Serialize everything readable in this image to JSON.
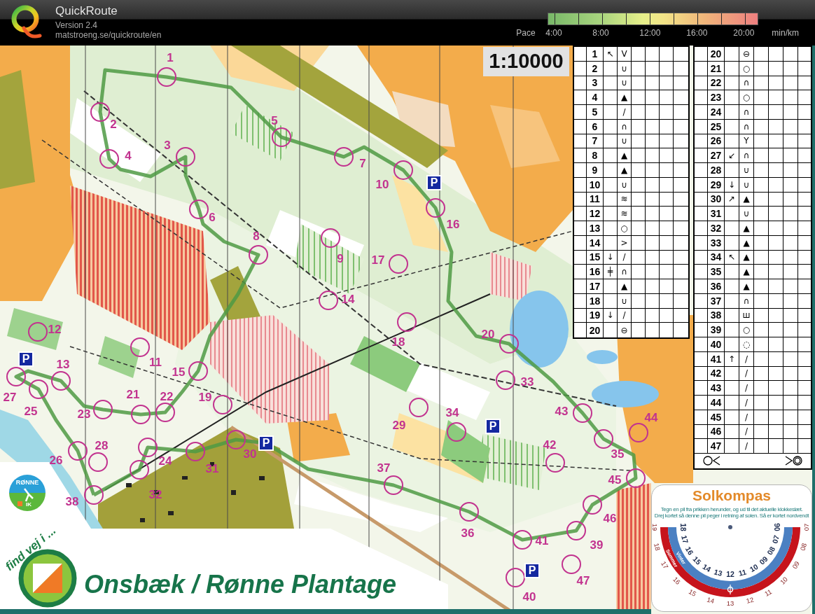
{
  "app_header": {
    "title": "QuickRoute",
    "version": "Version 2.4",
    "url": "matstroeng.se/quickroute/en"
  },
  "pace_legend": {
    "label": "Pace",
    "ticks": [
      "4:00",
      "8:00",
      "12:00",
      "16:00",
      "20:00"
    ],
    "unit": "min/km"
  },
  "map": {
    "scale": "1:10000",
    "controls": [
      "1",
      "2",
      "3",
      "4",
      "5",
      "6",
      "7",
      "8",
      "9",
      "10",
      "11",
      "12",
      "13",
      "14",
      "15",
      "16",
      "17",
      "18",
      "19",
      "20",
      "21",
      "22",
      "23",
      "24",
      "25",
      "26",
      "27",
      "28",
      "29",
      "30",
      "31",
      "32",
      "33",
      "34",
      "35",
      "36",
      "37",
      "38",
      "39",
      "40",
      "41",
      "42",
      "43",
      "44",
      "45",
      "46",
      "47"
    ],
    "parking_signs": [
      "P",
      "P",
      "P",
      "P",
      "P"
    ],
    "description_sheets": [
      {
        "start_finish_row": false,
        "rows": [
          {
            "number": "1",
            "column_c": "↖",
            "column_d": "V"
          },
          {
            "number": "2",
            "column_d": "∪"
          },
          {
            "number": "3",
            "column_d": "∪"
          },
          {
            "number": "4",
            "column_d": "▲"
          },
          {
            "number": "5",
            "column_d": "/"
          },
          {
            "number": "6",
            "column_d": "∩"
          },
          {
            "number": "7",
            "column_d": "∪"
          },
          {
            "number": "8",
            "column_d": "▲"
          },
          {
            "number": "9",
            "column_d": "▲"
          },
          {
            "number": "10",
            "column_d": "∪"
          },
          {
            "number": "11",
            "column_d": "≋"
          },
          {
            "number": "12",
            "column_d": "≋"
          },
          {
            "number": "13",
            "column_d": "○"
          },
          {
            "number": "14",
            "column_d": ">"
          },
          {
            "number": "15",
            "column_c": "↓",
            "column_d": "/"
          },
          {
            "number": "16",
            "column_c": "╪",
            "column_d": "∩"
          },
          {
            "number": "17",
            "column_d": "▲"
          },
          {
            "number": "18",
            "column_d": "∪"
          },
          {
            "number": "19",
            "column_c": "↓",
            "column_d": "/"
          },
          {
            "number": "20",
            "column_d": "⊖"
          }
        ]
      },
      {
        "start_finish_row": true,
        "rows": [
          {
            "number": "20",
            "column_d": "⊖"
          },
          {
            "number": "21",
            "column_d": "○"
          },
          {
            "number": "22",
            "column_d": "∩"
          },
          {
            "number": "23",
            "column_d": "○"
          },
          {
            "number": "24",
            "column_d": "∩"
          },
          {
            "number": "25",
            "column_d": "∩"
          },
          {
            "number": "26",
            "column_d": "Y"
          },
          {
            "number": "27",
            "column_c": "↙",
            "column_d": "∩"
          },
          {
            "number": "28",
            "column_d": "∪"
          },
          {
            "number": "29",
            "column_c": "↓",
            "column_d": "∪"
          },
          {
            "number": "30",
            "column_c": "↗",
            "column_d": "▲"
          },
          {
            "number": "31",
            "column_d": "∪"
          },
          {
            "number": "32",
            "column_d": "▲"
          },
          {
            "number": "33",
            "column_d": "▲"
          },
          {
            "number": "34",
            "column_c": "↖",
            "column_d": "▲"
          },
          {
            "number": "35",
            "column_d": "▲"
          },
          {
            "number": "36",
            "column_d": "▲"
          },
          {
            "number": "37",
            "column_d": "∩"
          },
          {
            "number": "38",
            "column_d": "ш"
          },
          {
            "number": "39",
            "column_d": "○"
          },
          {
            "number": "40",
            "column_d": "◌"
          },
          {
            "number": "41",
            "column_c": "↑",
            "column_d": "/"
          },
          {
            "number": "42",
            "column_d": "/"
          },
          {
            "number": "43",
            "column_d": "/"
          },
          {
            "number": "44",
            "column_d": "/"
          },
          {
            "number": "45",
            "column_d": "/"
          },
          {
            "number": "46",
            "column_d": "/"
          },
          {
            "number": "47",
            "column_d": "/"
          }
        ]
      }
    ],
    "club_logo": {
      "name": "RØNNE",
      "suffix": "IK"
    },
    "banner": {
      "tagline": "find vej i ...",
      "title": "Onsbæk / Rønne Plantage"
    },
    "sun_compass": {
      "title": "Solkompas",
      "instructions": [
        "Tegn en pil fra prikken herunder, og ud til det aktuelle klokkeslæt.",
        "Drej kortet så denne pil peger i retning af solen. Så er kortet nordvendt"
      ],
      "winter_label": "Vinter",
      "summer_label": "Sommer",
      "winter_hours": [
        "18",
        "17",
        "16",
        "15",
        "14",
        "13",
        "12",
        "11",
        "10",
        "09",
        "08",
        "07",
        "06"
      ],
      "summer_hours": [
        "19",
        "18",
        "17",
        "16",
        "15",
        "14",
        "13",
        "12",
        "11",
        "10",
        "09",
        "08",
        "07"
      ]
    }
  }
}
